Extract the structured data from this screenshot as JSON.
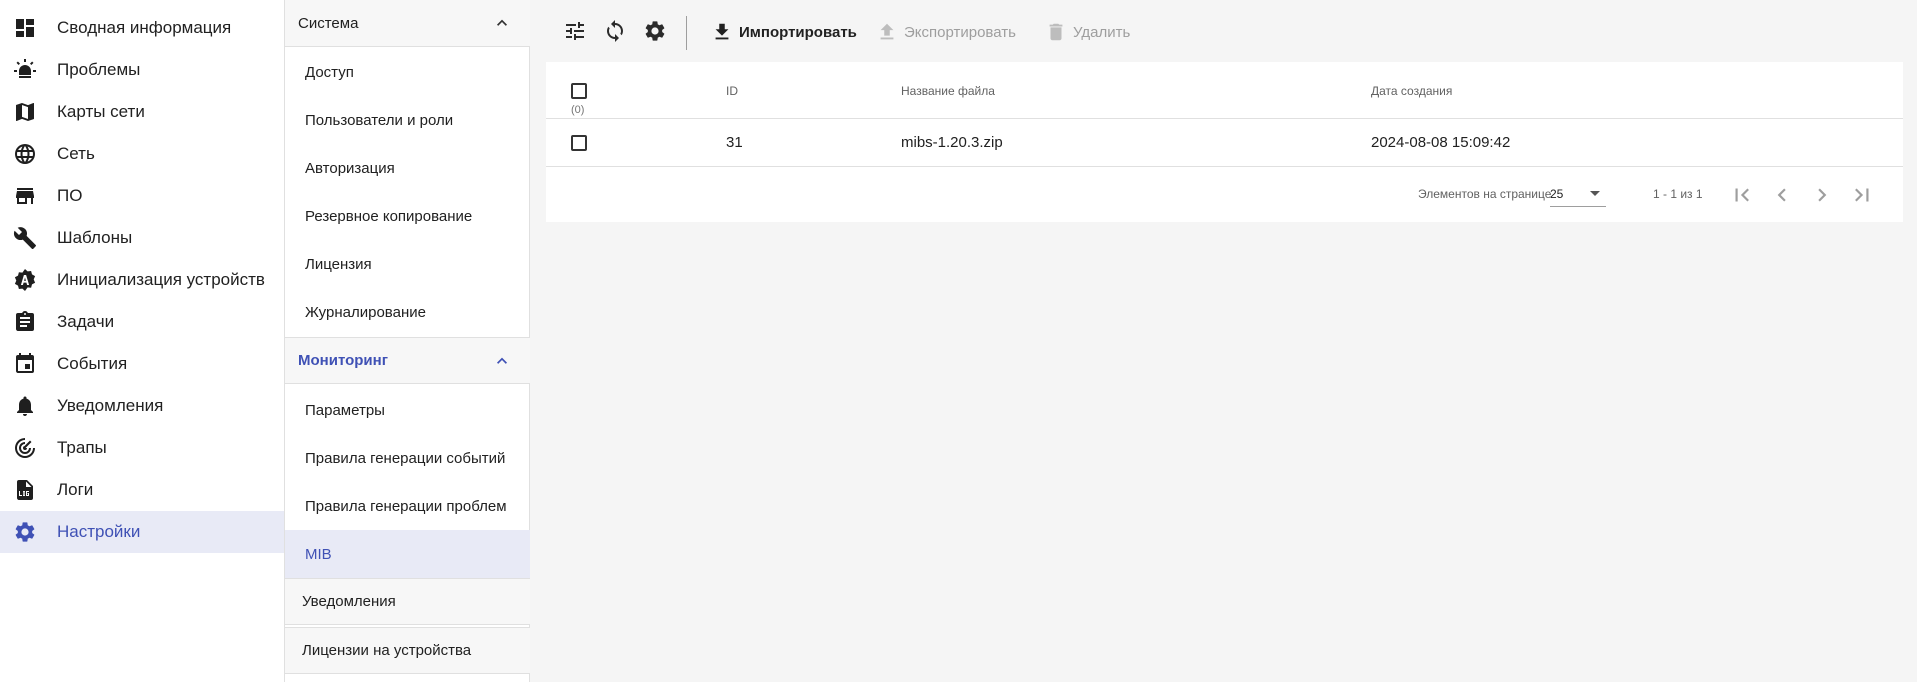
{
  "nav": {
    "items": [
      {
        "label": "Сводная информация",
        "icon": "dashboard-icon"
      },
      {
        "label": "Проблемы",
        "icon": "alarm-light-icon"
      },
      {
        "label": "Карты сети",
        "icon": "map-icon"
      },
      {
        "label": "Сеть",
        "icon": "globe-icon"
      },
      {
        "label": "ПО",
        "icon": "store-icon"
      },
      {
        "label": "Шаблоны",
        "icon": "wrench-icon"
      },
      {
        "label": "Инициализация устройств",
        "icon": "badge-a-icon"
      },
      {
        "label": "Задачи",
        "icon": "clipboard-icon"
      },
      {
        "label": "События",
        "icon": "calendar-icon"
      },
      {
        "label": "Уведомления",
        "icon": "bell-icon"
      },
      {
        "label": "Трапы",
        "icon": "radar-icon"
      },
      {
        "label": "Логи",
        "icon": "log-file-icon"
      },
      {
        "label": "Настройки",
        "icon": "gear-icon"
      }
    ]
  },
  "submenu": {
    "system": {
      "title": "Система",
      "items": [
        "Доступ",
        "Пользователи и роли",
        "Авторизация",
        "Резервное копирование",
        "Лицензия",
        "Журналирование"
      ]
    },
    "monitoring": {
      "title": "Мониторинг",
      "items": [
        "Параметры",
        "Правила генерации событий",
        "Правила генерации проблем",
        "MIB"
      ]
    },
    "notifications": {
      "title": "Уведомления"
    },
    "device_licenses": {
      "title": "Лицензии на устройства"
    }
  },
  "toolbar": {
    "filter_icon": "tune-icon",
    "refresh_icon": "refresh-icon",
    "settings_icon": "gear-icon",
    "import_label": "Импортировать",
    "export_label": "Экспортировать",
    "delete_label": "Удалить"
  },
  "table": {
    "columns": {
      "id": "ID",
      "filename": "Название файла",
      "created": "Дата создания"
    },
    "selected_count": "(0)",
    "rows": [
      {
        "id": "31",
        "filename": "mibs-1.20.3.zip",
        "created": "2024-08-08 15:09:42"
      }
    ]
  },
  "pager": {
    "items_per_page_label": "Элементов на странице",
    "page_size": "25",
    "range": "1 - 1 из 1"
  },
  "colors": {
    "accent": "#3f51b5",
    "active_bg": "#e8eaf6"
  }
}
